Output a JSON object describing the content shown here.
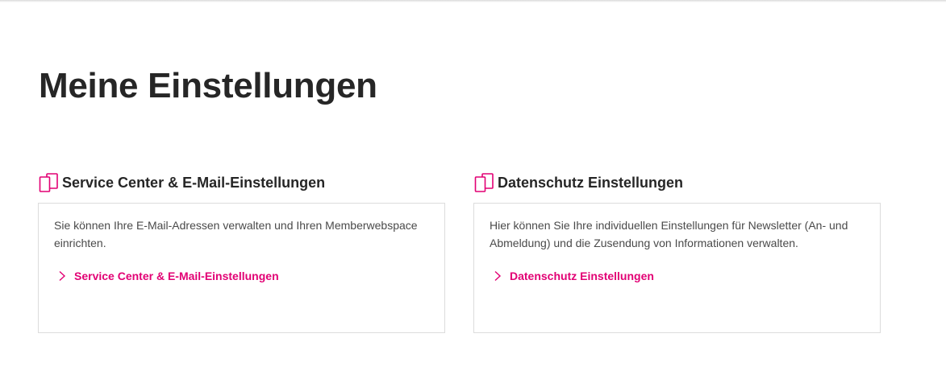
{
  "page": {
    "title": "Meine Einstellungen"
  },
  "colors": {
    "accent": "#e20074",
    "text": "#262626",
    "border": "#dcdcdc"
  },
  "sections": [
    {
      "icon": "devices-icon",
      "title": "Service Center & E-Mail-Einstellungen",
      "description": "Sie können Ihre E-Mail-Adressen verwalten und Ihren Memberwebspace einrichten.",
      "link_label": "Service Center & E-Mail-Einstellungen"
    },
    {
      "icon": "devices-icon",
      "title": "Datenschutz Einstellungen",
      "description": "Hier können Sie Ihre individuellen Einstellungen für Newsletter (An- und Abmeldung) und die Zusendung von Informationen verwalten.",
      "link_label": "Datenschutz Einstellungen"
    }
  ]
}
